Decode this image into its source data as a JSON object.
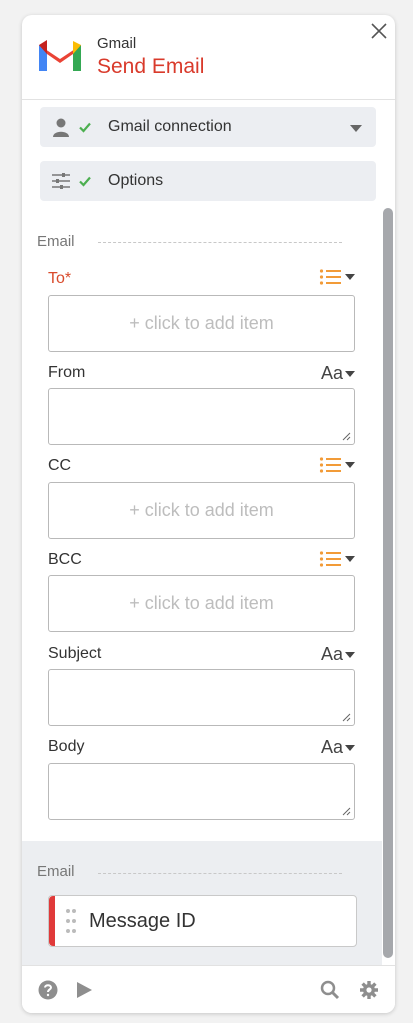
{
  "header": {
    "app_name": "Gmail",
    "action_title": "Send Email",
    "brand_color": "#d93a2b"
  },
  "sections": {
    "connection": {
      "label": "Gmail connection",
      "status": "complete"
    },
    "options": {
      "label": "Options",
      "status": "complete"
    }
  },
  "input_group": {
    "title": "Email",
    "fields": [
      {
        "label": "To*",
        "required": true,
        "type": "list",
        "placeholder": "+ click to add item"
      },
      {
        "label": "From",
        "type": "text",
        "toggle": "Aa"
      },
      {
        "label": "CC",
        "type": "list",
        "placeholder": "+ click to add item"
      },
      {
        "label": "BCC",
        "type": "list",
        "placeholder": "+ click to add item"
      },
      {
        "label": "Subject",
        "type": "text",
        "toggle": "Aa"
      },
      {
        "label": "Body",
        "type": "text",
        "toggle": "Aa"
      }
    ]
  },
  "output_group": {
    "title": "Email",
    "items": [
      {
        "label": "Message ID",
        "accent": "#e03a3a"
      }
    ]
  },
  "footer": {
    "icons": [
      "help-icon",
      "play-icon",
      "search-icon",
      "gear-icon"
    ]
  },
  "colors": {
    "required": "#d94a2b",
    "list_icon": "#f29b38",
    "check": "#4caf50",
    "panel_bg": "#ffffff",
    "section_bg": "#eceef2"
  }
}
